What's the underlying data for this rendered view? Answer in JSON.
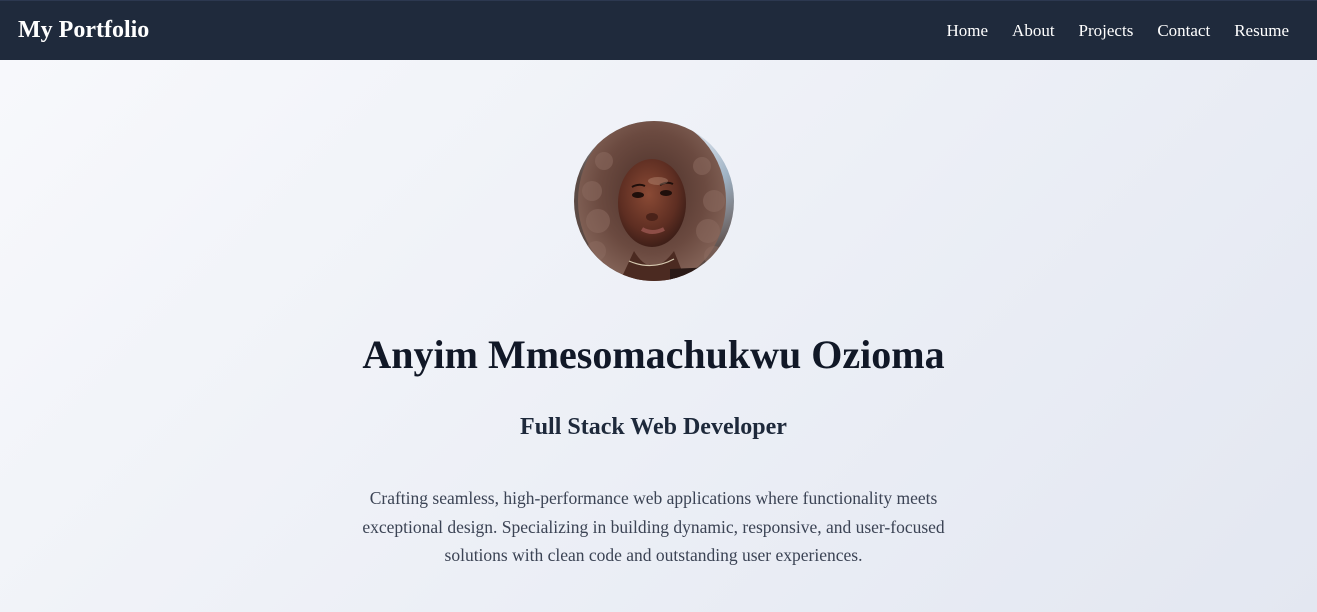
{
  "header": {
    "brand": "My Portfolio",
    "nav": [
      "Home",
      "About",
      "Projects",
      "Contact",
      "Resume"
    ]
  },
  "hero": {
    "name": "Anyim Mmesomachukwu Ozioma",
    "role": "Full Stack Web Developer",
    "bio": "Crafting seamless, high-performance web applications where functionality meets exceptional design. Specializing in building dynamic, responsive, and user-focused solutions with clean code and outstanding user experiences."
  },
  "colors": {
    "header_bg": "#1f2a3c",
    "heading": "#111827",
    "body_text": "#3b4354"
  }
}
